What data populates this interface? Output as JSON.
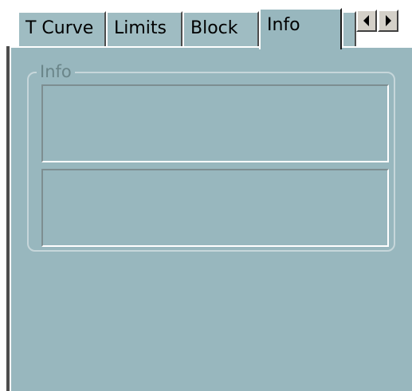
{
  "tabs": [
    {
      "label": "T Curve",
      "active": false
    },
    {
      "label": "Limits",
      "active": false
    },
    {
      "label": "Block",
      "active": false
    },
    {
      "label": "Info",
      "active": true
    }
  ],
  "scroll_buttons": {
    "left_icon": "arrow-left-icon",
    "right_icon": "arrow-right-icon"
  },
  "info_group": {
    "label": "Info",
    "box1_text": "",
    "box2_text": ""
  },
  "colors": {
    "panel_bg": "#98b7be",
    "tab_bg": "#9fbcc2",
    "button_face": "#d4d0c8"
  }
}
